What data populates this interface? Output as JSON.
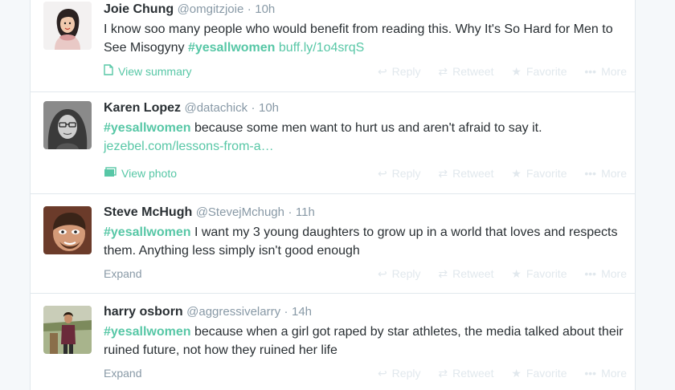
{
  "tweets": [
    {
      "fullname": "Joie Chung",
      "username": "@omgitzjoie",
      "time": "10h",
      "text_parts": [
        "I know soo many people who would benefit from reading this. Why It's So Hard for Men to See Misogyny ",
        "#yesallwomen",
        " ",
        "buff.ly/1o4srqS"
      ],
      "footer_left": "View summary",
      "footer_icon": "summary-icon"
    },
    {
      "fullname": "Karen Lopez",
      "username": "@datachick",
      "time": "10h",
      "text_parts": [
        "#yesallwomen",
        "  because some men want to hurt us and aren't afraid to say it. ",
        "jezebel.com/lessons-from-a…"
      ],
      "footer_left": "View photo",
      "footer_icon": "photo-icon"
    },
    {
      "fullname": "Steve McHugh",
      "username": "@StevejMchugh",
      "time": "11h",
      "text_parts": [
        "#yesallwomen",
        " I want my 3 young daughters to grow up in a world that loves and respects them. Anything less simply isn't good enough"
      ],
      "footer_left": "Expand"
    },
    {
      "fullname": "harry osborn",
      "username": "@aggressivelarry",
      "time": "14h",
      "text_parts": [
        "#yesallwomen",
        " because when a girl got raped by star athletes, the media talked about their ruined future, not how they ruined her life"
      ],
      "footer_left": "Expand"
    }
  ],
  "actions": {
    "reply": "Reply",
    "retweet": "Retweet",
    "favorite": "Favorite",
    "more": "More"
  },
  "separator": "·"
}
